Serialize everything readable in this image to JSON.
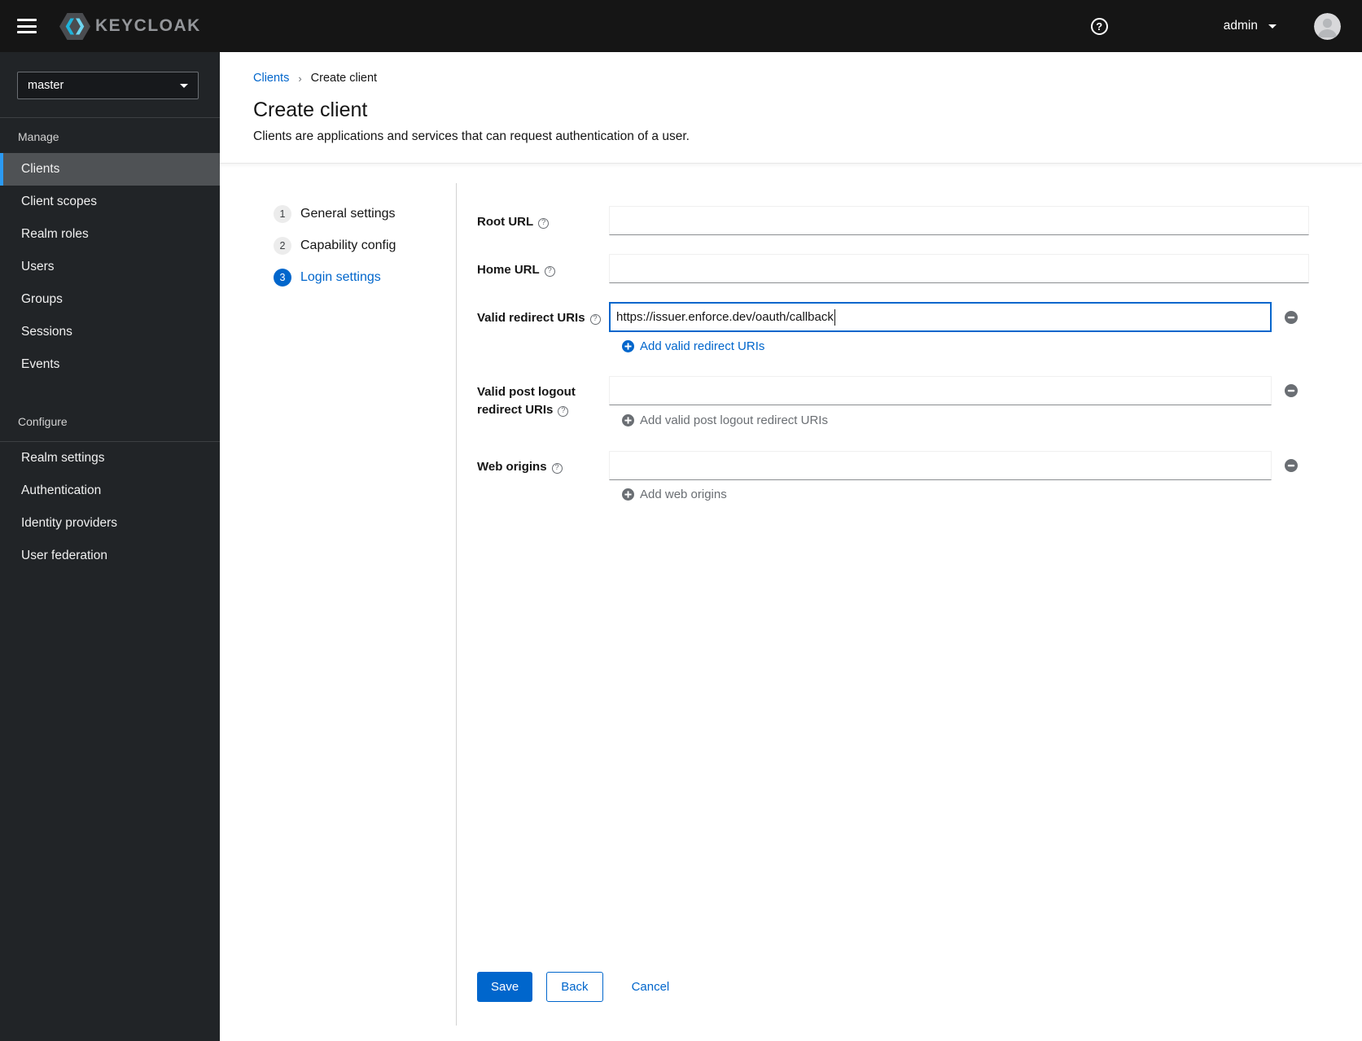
{
  "masthead": {
    "brand": "KEYCLOAK",
    "username": "admin"
  },
  "sidebar": {
    "realm": "master",
    "manage": {
      "label": "Manage",
      "items": [
        "Clients",
        "Client scopes",
        "Realm roles",
        "Users",
        "Groups",
        "Sessions",
        "Events"
      ],
      "active_item": "Clients"
    },
    "configure": {
      "label": "Configure",
      "items": [
        "Realm settings",
        "Authentication",
        "Identity providers",
        "User federation"
      ]
    }
  },
  "breadcrumb": {
    "items": [
      "Clients",
      "Create client"
    ]
  },
  "page": {
    "title": "Create client",
    "description": "Clients are applications and services that can request authentication of a user."
  },
  "wizard": {
    "active_step": "Login settings",
    "steps": [
      {
        "number": "1",
        "label": "General settings"
      },
      {
        "number": "2",
        "label": "Capability config"
      },
      {
        "number": "3",
        "label": "Login settings"
      }
    ]
  },
  "form": {
    "root_url": {
      "label": "Root URL",
      "value": ""
    },
    "home_url": {
      "label": "Home URL",
      "value": ""
    },
    "valid_redirect_uris": {
      "label": "Valid redirect URIs",
      "value": "https://issuer.enforce.dev/oauth/callback",
      "add_label": "Add valid redirect URIs"
    },
    "post_logout_redirect_uris": {
      "label": "Valid post logout redirect URIs",
      "value": "",
      "add_label": "Add valid post logout redirect URIs"
    },
    "web_origins": {
      "label": "Web origins",
      "value": "",
      "add_label": "Add web origins"
    }
  },
  "actions": {
    "save": "Save",
    "back": "Back",
    "cancel": "Cancel"
  },
  "colors": {
    "accent": "#0066cc",
    "masthead_bg": "#151515",
    "sidebar_bg": "#212427",
    "sidebar_active_bg": "#4f5255",
    "active_indicator": "#2b9af3",
    "muted_gray": "#6a6e73",
    "divider": "#d2d2d2"
  }
}
